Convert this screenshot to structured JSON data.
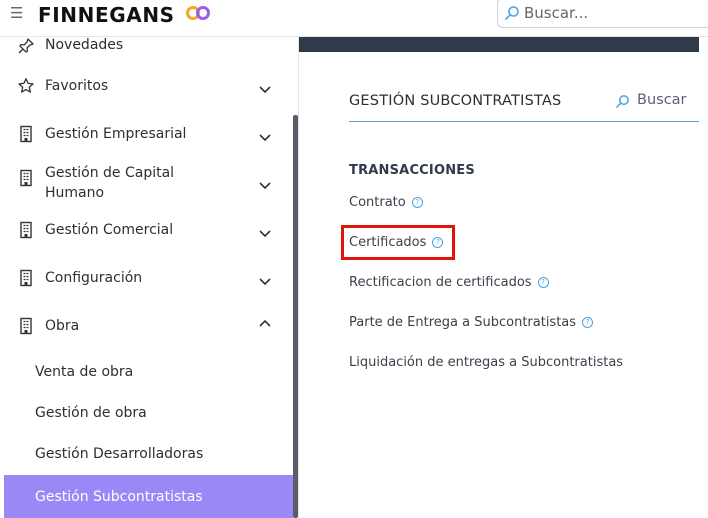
{
  "header": {
    "brand": "FINNEGANS",
    "search_placeholder": "Buscar..."
  },
  "sidebar": {
    "items": [
      {
        "label": "Novedades",
        "icon": "pin-icon"
      },
      {
        "label": "Favoritos",
        "icon": "star-icon",
        "expanded": false
      },
      {
        "label": "Gestión Empresarial",
        "icon": "building-icon",
        "expanded": false
      },
      {
        "label": "Gestión de Capital\nHumano",
        "icon": "building-icon",
        "expanded": false
      },
      {
        "label": "Gestión Comercial",
        "icon": "building-icon",
        "expanded": false
      },
      {
        "label": "Configuración",
        "icon": "building-icon",
        "expanded": false
      },
      {
        "label": "Obra",
        "icon": "building-icon",
        "expanded": true
      }
    ],
    "obra_subitems": [
      {
        "label": "Venta de obra"
      },
      {
        "label": "Gestión de obra"
      },
      {
        "label": "Gestión Desarrolladoras"
      },
      {
        "label": "Gestión Subcontratistas",
        "active": true
      }
    ]
  },
  "main": {
    "title": "GESTIÓN SUBCONTRATISTAS",
    "search_label": "Buscar",
    "section_title": "TRANSACCIONES",
    "transactions": [
      {
        "label": "Contrato",
        "help": true
      },
      {
        "label": "Certificados",
        "help": true,
        "highlighted": true
      },
      {
        "label": "Rectificacion de certificados",
        "help": true
      },
      {
        "label": "Parte de Entrega a Subcontratistas",
        "help": true
      },
      {
        "label": "Liquidación de entregas a Subcontratistas",
        "help": false
      }
    ]
  },
  "colors": {
    "active_item_bg": "#9b87f5",
    "accent_line": "#5aa8d6",
    "help_icon": "#4aa3df",
    "highlight_box": "#e0140a",
    "top_strip": "#2f3a4b"
  }
}
